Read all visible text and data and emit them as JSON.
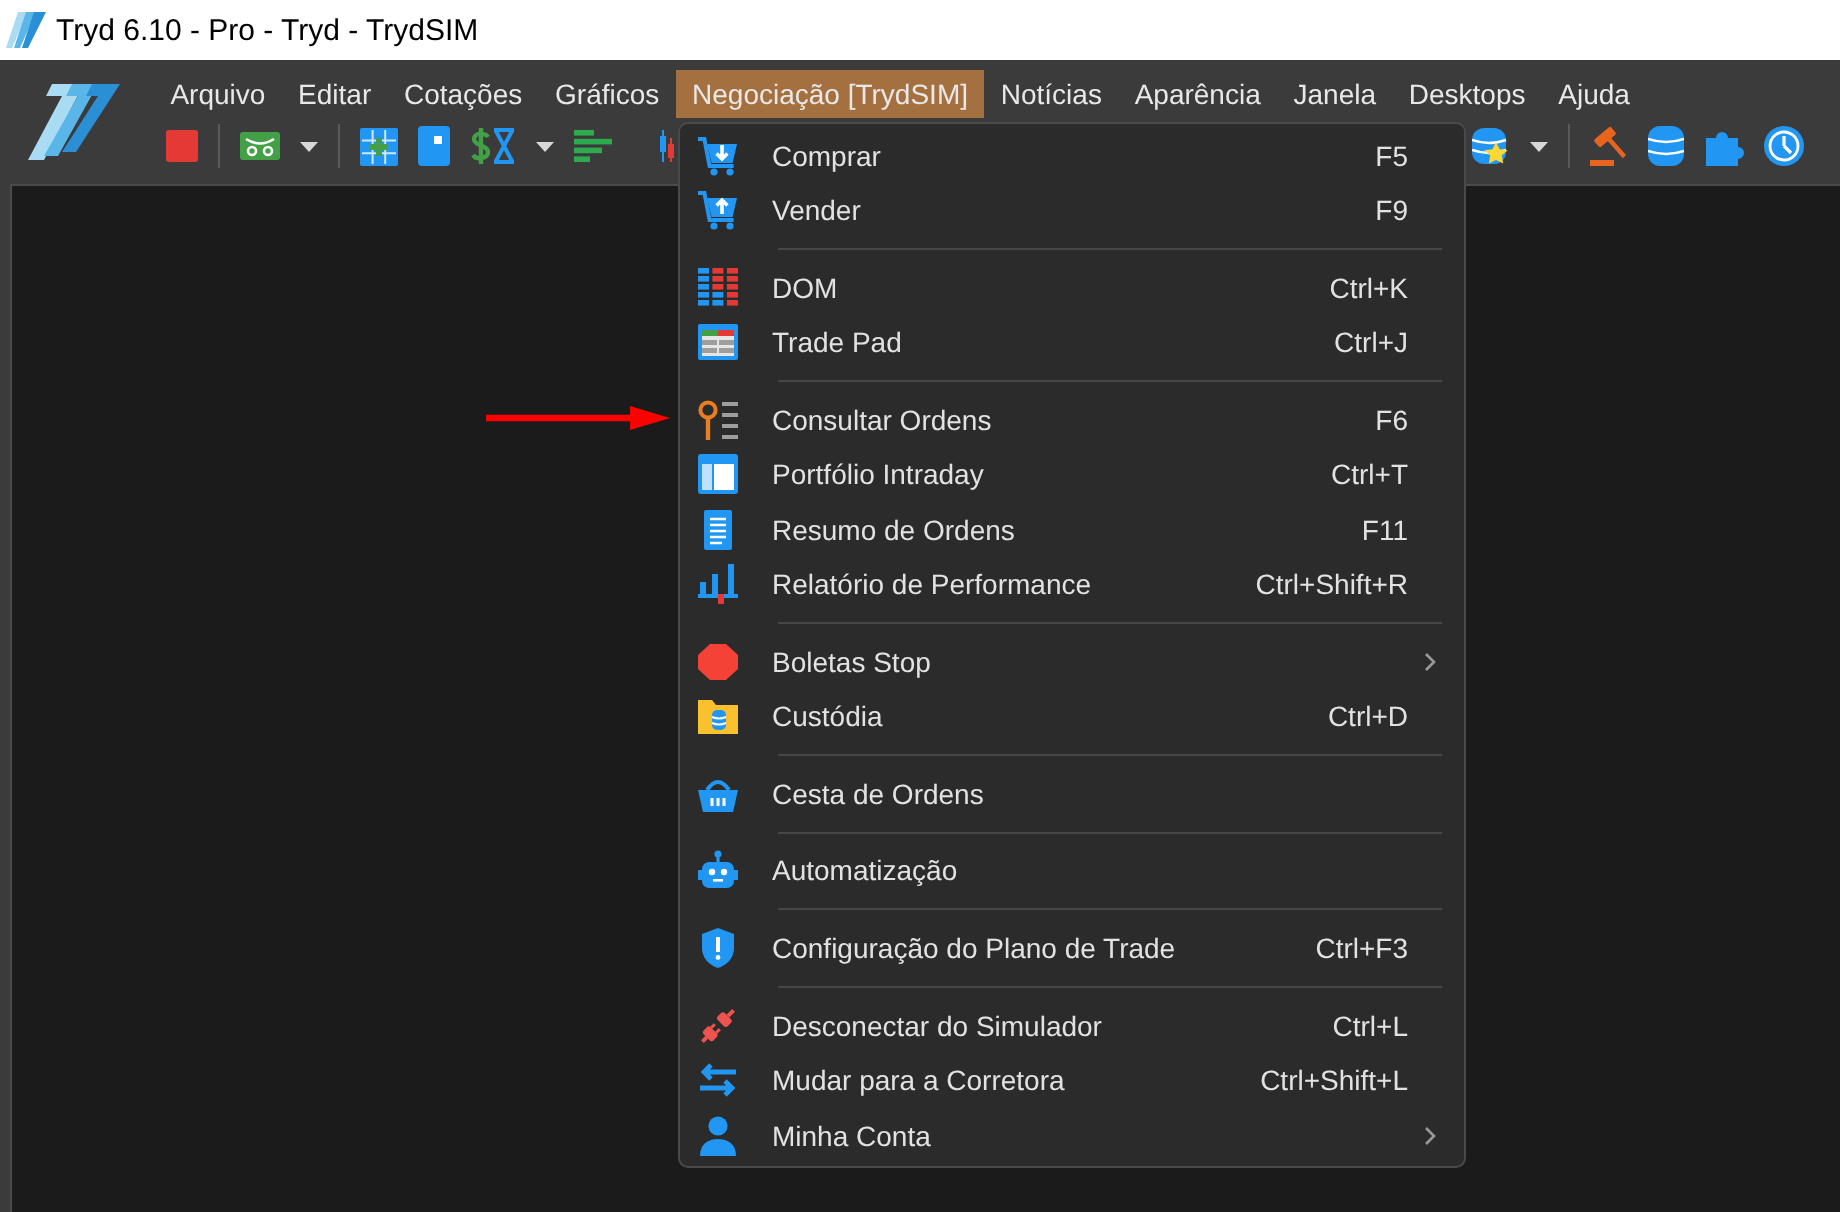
{
  "window": {
    "title": "Tryd 6.10 - Pro - Tryd - TrydSIM"
  },
  "menu_bar": [
    {
      "label": "Arquivo",
      "selected": false
    },
    {
      "label": "Editar",
      "selected": false
    },
    {
      "label": "Cotações",
      "selected": false
    },
    {
      "label": "Gráficos",
      "selected": false
    },
    {
      "label": "Negociação [TrydSIM]",
      "selected": true
    },
    {
      "label": "Notícias",
      "selected": false
    },
    {
      "label": "Aparência",
      "selected": false
    },
    {
      "label": "Janela",
      "selected": false
    },
    {
      "label": "Desktops",
      "selected": false
    },
    {
      "label": "Ajuda",
      "selected": false
    }
  ],
  "dropdown_menu": {
    "sections": [
      {
        "items": [
          {
            "kind": "command",
            "label": "Comprar",
            "shortcut": "F5"
          },
          {
            "kind": "command",
            "label": "Vender",
            "shortcut": "F9"
          }
        ]
      },
      {
        "items": [
          {
            "kind": "command",
            "label": "DOM",
            "shortcut": "Ctrl+K"
          },
          {
            "kind": "command",
            "label": "Trade Pad",
            "shortcut": "Ctrl+J"
          }
        ]
      },
      {
        "items": [
          {
            "kind": "command",
            "label": "Consultar Ordens",
            "shortcut": "F6"
          },
          {
            "kind": "command",
            "label": "Portfólio Intraday",
            "shortcut": "Ctrl+T"
          },
          {
            "kind": "command",
            "label": "Resumo de Ordens",
            "shortcut": "F11"
          },
          {
            "kind": "command",
            "label": "Relatório de Performance",
            "shortcut": "Ctrl+Shift+R"
          }
        ]
      },
      {
        "items": [
          {
            "kind": "submenu",
            "label": "Boletas Stop"
          },
          {
            "kind": "command",
            "label": "Custódia",
            "shortcut": "Ctrl+D"
          }
        ]
      },
      {
        "items": [
          {
            "kind": "command",
            "label": "Cesta de Ordens"
          }
        ]
      },
      {
        "items": [
          {
            "kind": "command",
            "label": "Automatização"
          }
        ]
      },
      {
        "items": [
          {
            "kind": "command",
            "label": "Configuração do Plano de Trade",
            "shortcut": "Ctrl+F3"
          }
        ]
      },
      {
        "items": [
          {
            "kind": "command",
            "label": "Desconectar do Simulador",
            "shortcut": "Ctrl+L"
          },
          {
            "kind": "command",
            "label": "Mudar para a Corretora",
            "shortcut": "Ctrl+Shift+L"
          },
          {
            "kind": "submenu",
            "label": "Minha Conta"
          }
        ]
      }
    ]
  }
}
